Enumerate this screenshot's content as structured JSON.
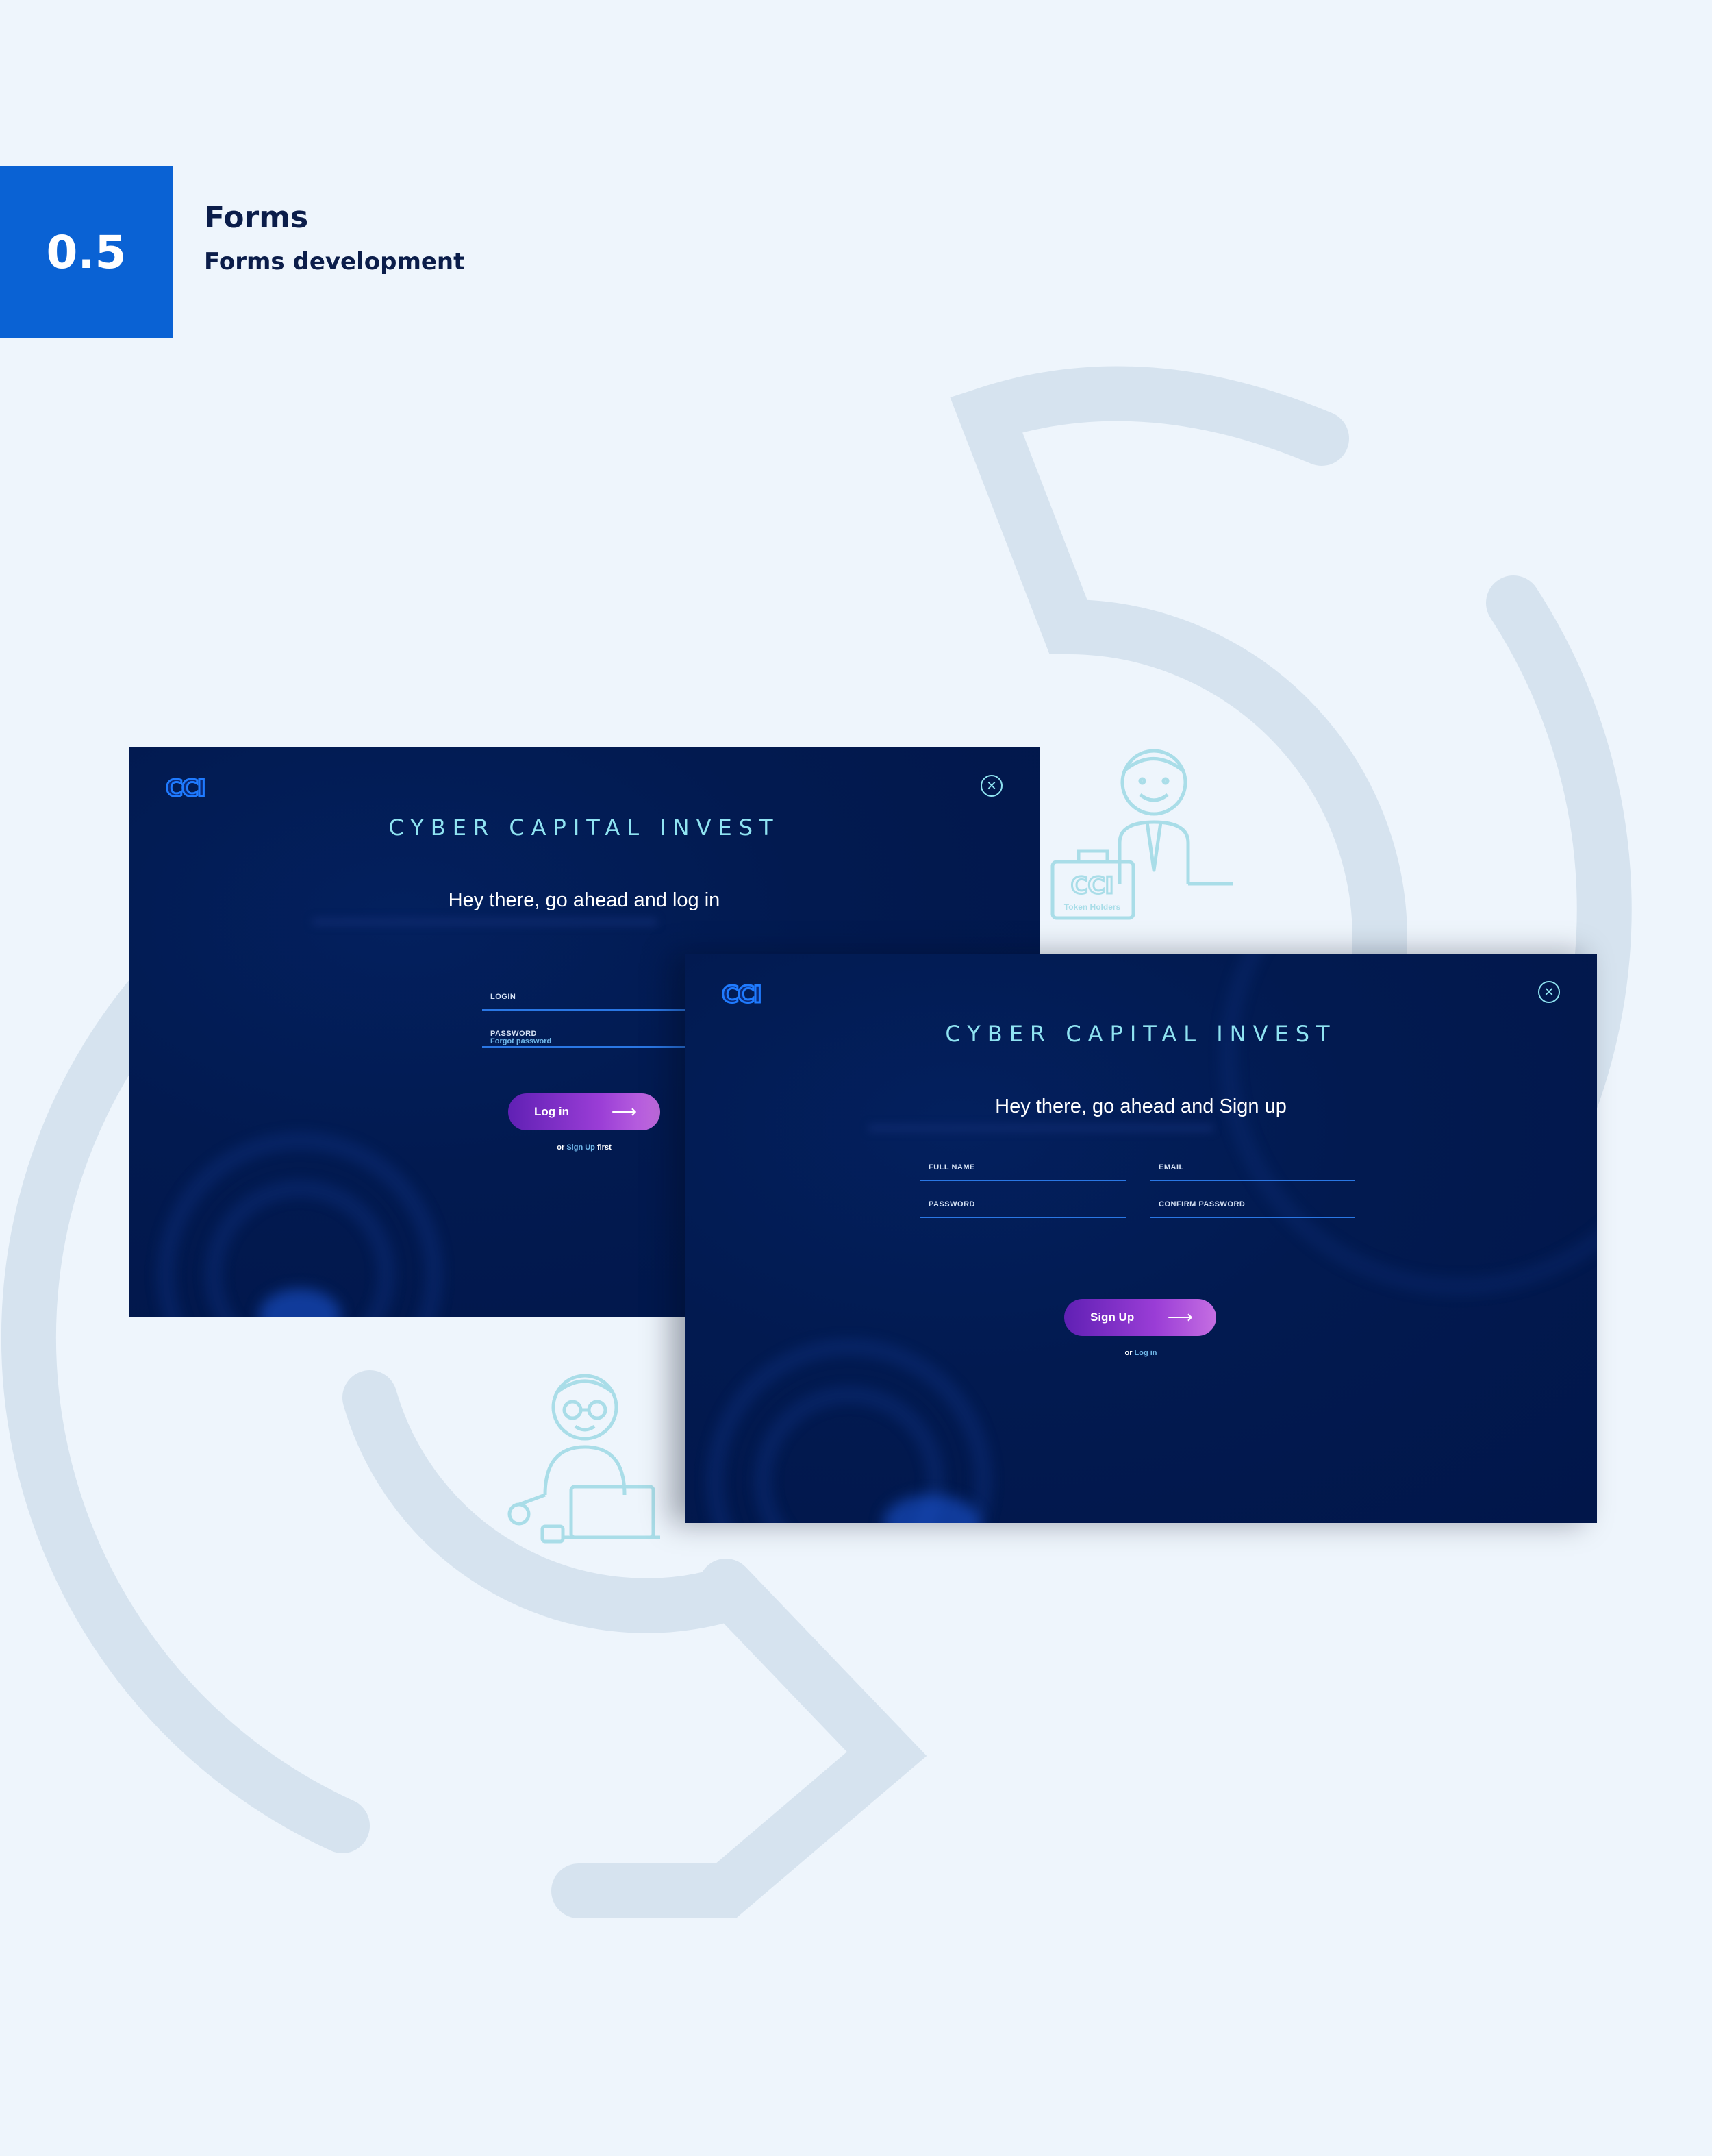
{
  "section": {
    "number": "0.5",
    "title": "Forms",
    "subtitle": "Forms development"
  },
  "login_screen": {
    "logo": "CCI",
    "brand": "CYBER CAPITAL INVEST",
    "heading": "Hey there, go ahead and log in",
    "fields": {
      "login": "LOGIN",
      "password": "PASSWORD"
    },
    "forgot_password": "Forgot password",
    "button": "Log in",
    "alt_prefix": "or",
    "alt_link": "Sign Up",
    "alt_suffix": "first"
  },
  "signup_screen": {
    "logo": "CCI",
    "brand": "CYBER CAPITAL INVEST",
    "heading": "Hey there, go ahead and Sign up",
    "fields": {
      "full_name": "FULL NAME",
      "email": "EMAIL",
      "password": "PASSWORD",
      "confirm_password": "CONFIRM PASSWORD"
    },
    "button": "Sign Up",
    "alt_prefix": "or",
    "alt_link": "Log in"
  },
  "illustrations": {
    "briefcase_logo": "CCI",
    "briefcase_caption": "Token Holders"
  },
  "colors": {
    "accent": "#0a62d4",
    "screen_bg": "#01164a",
    "cyan": "#8fe3f1",
    "field_line": "#2a77e4",
    "button_start": "#6020b4",
    "button_end": "#c56ee2"
  },
  "icons": {
    "close": "close-icon",
    "arrow": "arrow-right-icon"
  }
}
